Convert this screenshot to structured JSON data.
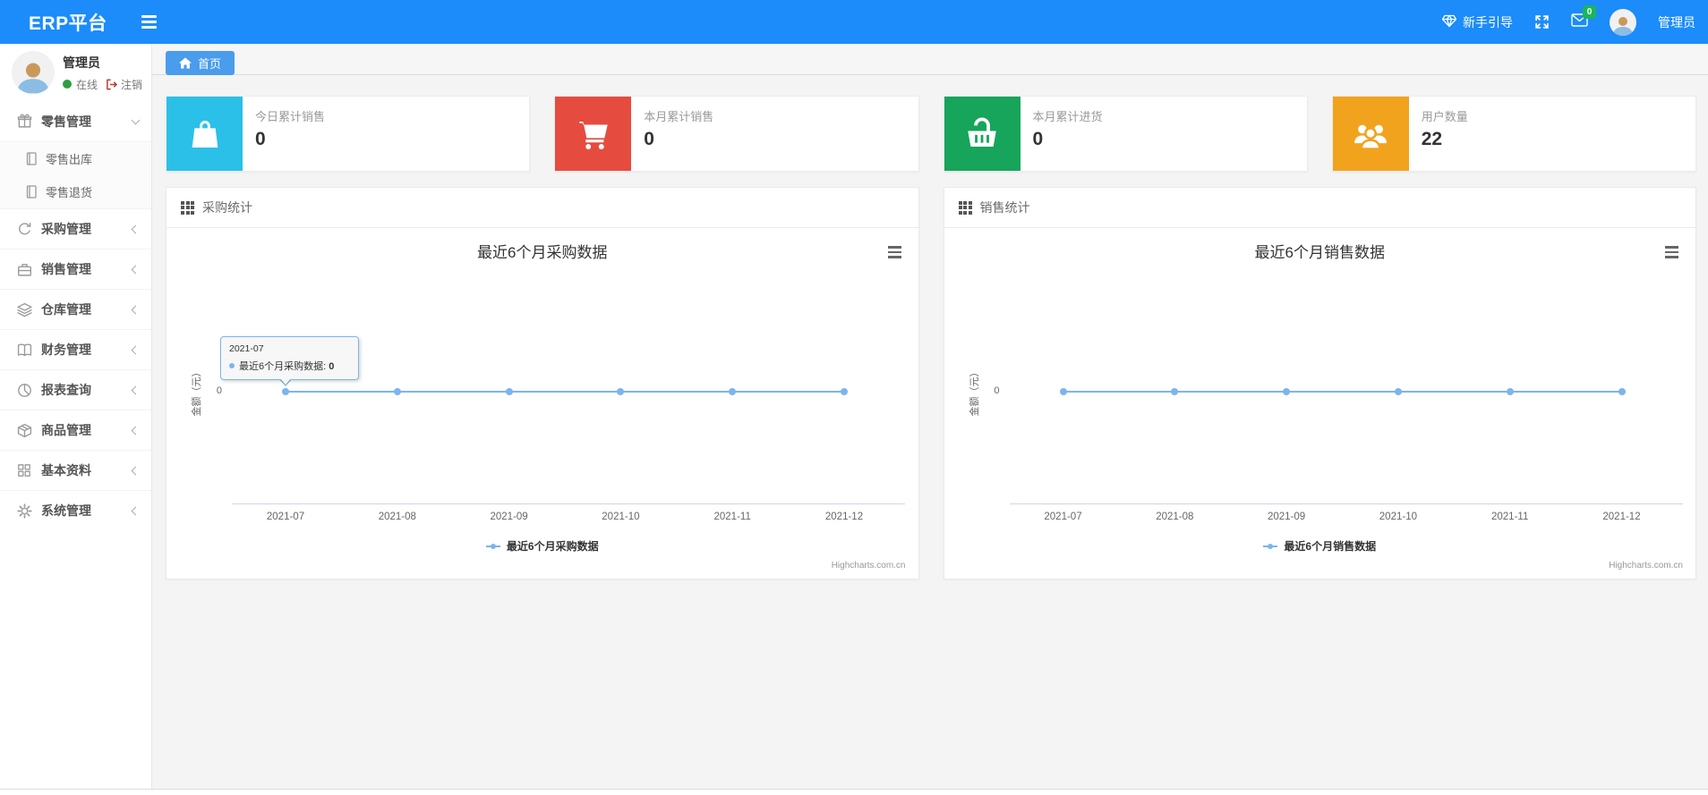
{
  "navbar": {
    "brand": "ERP平台",
    "guide_label": "新手引导",
    "message_badge": "0",
    "username": "管理员"
  },
  "sidebar": {
    "user": {
      "name": "管理员",
      "status": "在线",
      "logout_label": "注销"
    },
    "menu": [
      {
        "label": "零售管理",
        "icon": "gift-icon",
        "expanded": true,
        "children": [
          {
            "label": "零售出库",
            "icon": "journal-icon"
          },
          {
            "label": "零售退货",
            "icon": "journal-icon"
          }
        ]
      },
      {
        "label": "采购管理",
        "icon": "procurement-icon"
      },
      {
        "label": "销售管理",
        "icon": "briefcase-icon"
      },
      {
        "label": "仓库管理",
        "icon": "layers-icon"
      },
      {
        "label": "财务管理",
        "icon": "ledger-icon"
      },
      {
        "label": "报表查询",
        "icon": "pie-chart-icon"
      },
      {
        "label": "商品管理",
        "icon": "package-icon"
      },
      {
        "label": "基本资料",
        "icon": "grid-icon"
      },
      {
        "label": "系统管理",
        "icon": "gear-icon"
      }
    ]
  },
  "tabs": [
    {
      "label": "首页",
      "icon": "home-icon",
      "active": true
    }
  ],
  "stat_cards": [
    {
      "label": "今日累计销售",
      "value": "0",
      "color": "#2ac0e8",
      "icon": "shopping-bag-icon"
    },
    {
      "label": "本月累计销售",
      "value": "0",
      "color": "#e54c3f",
      "icon": "shopping-cart-icon"
    },
    {
      "label": "本月累计进货",
      "value": "0",
      "color": "#17a45b",
      "icon": "shopping-basket-icon"
    },
    {
      "label": "用户数量",
      "value": "22",
      "color": "#f2a31d",
      "icon": "users-icon"
    }
  ],
  "panels": [
    {
      "title": "采购统计"
    },
    {
      "title": "销售统计"
    }
  ],
  "chart_data": [
    {
      "type": "line",
      "title": "最近6个月采购数据",
      "x": [
        "2021-07",
        "2021-08",
        "2021-09",
        "2021-10",
        "2021-11",
        "2021-12"
      ],
      "series": [
        {
          "name": "最近6个月采购数据",
          "values": [
            0,
            0,
            0,
            0,
            0,
            0
          ],
          "color": "#7cb5ec"
        }
      ],
      "ylabel": "金额（元）",
      "yticks": [
        "0"
      ],
      "ylim": [
        -1,
        1
      ],
      "grid": false,
      "legend_position": "bottom",
      "credit": "Highcharts.com.cn",
      "tooltip": {
        "header": "2021-07",
        "series": "最近6个月采购数据",
        "value": "0"
      }
    },
    {
      "type": "line",
      "title": "最近6个月销售数据",
      "x": [
        "2021-07",
        "2021-08",
        "2021-09",
        "2021-10",
        "2021-11",
        "2021-12"
      ],
      "series": [
        {
          "name": "最近6个月销售数据",
          "values": [
            0,
            0,
            0,
            0,
            0,
            0
          ],
          "color": "#7cb5ec"
        }
      ],
      "ylabel": "金额（元）",
      "yticks": [
        "0"
      ],
      "ylim": [
        -1,
        1
      ],
      "grid": false,
      "legend_position": "bottom",
      "credit": "Highcharts.com.cn"
    }
  ]
}
